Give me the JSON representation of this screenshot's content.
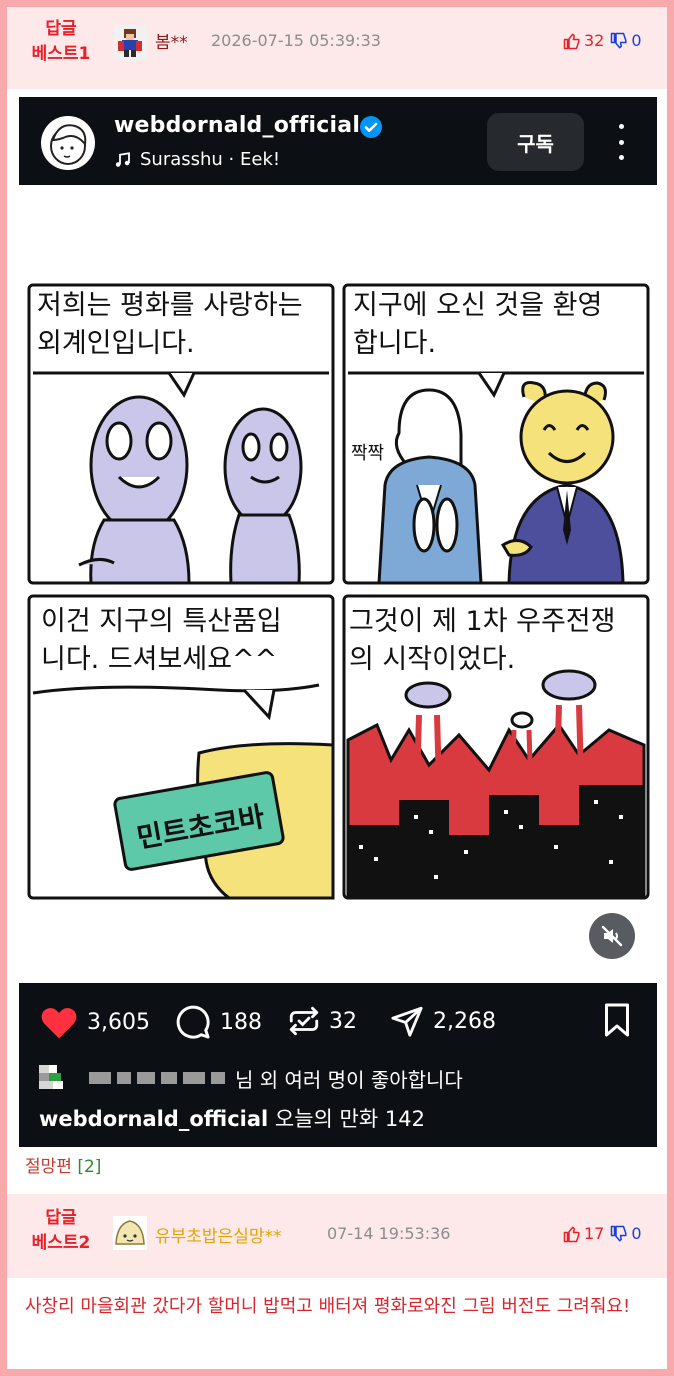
{
  "replies": [
    {
      "best_label": "답글\n베스트1",
      "nickname": "봄**",
      "nickname_color": "#8b1a1a",
      "date": "2026-07-15 05:39:33",
      "up": "32",
      "down": "0"
    },
    {
      "best_label": "답글\n베스트2",
      "nickname": "유부초밥은실망**",
      "nickname_color": "#e1a500",
      "date": "07-14 19:53:36",
      "up": "17",
      "down": "0",
      "text": "사창리 마을회관 갔다가 할머니 밥먹고 배터져 평화로와진 그림 버전도 그려줘요!"
    }
  ],
  "embed": {
    "account": "webdornald_official",
    "music": "Surasshu · Eek!",
    "subscribe_label": "구독",
    "likes": "3,605",
    "comments": "188",
    "reposts": "32",
    "shares": "2,268",
    "liked_by": "님 외 여러 명이 좋아합니다",
    "caption_user": "webdornald_official",
    "caption_text": "오늘의 만화 142"
  },
  "comic": {
    "panel1": "저희는 평화를 사랑하는\n외계인입니다.",
    "panel2": "지구에 오신 것을 환영\n합니다.",
    "panel2_sfx": "짝짝",
    "panel3": "이건 지구의 특산품입\n니다. 드셔보세요^^",
    "panel3_bar": "민트초코바",
    "panel4": "그것이 제 1차 우주전쟁\n의 시작이었다."
  },
  "post_title": {
    "text": "절망편",
    "count": "[2]"
  },
  "colors": {
    "border": "#f7a9ab",
    "header_bg": "#fde9ea",
    "accent_red": "#e8202a",
    "accent_blue": "#1a3fd6",
    "instagram_bg": "#0c1014",
    "heart": "#ff3040",
    "verified": "#0095f6"
  }
}
